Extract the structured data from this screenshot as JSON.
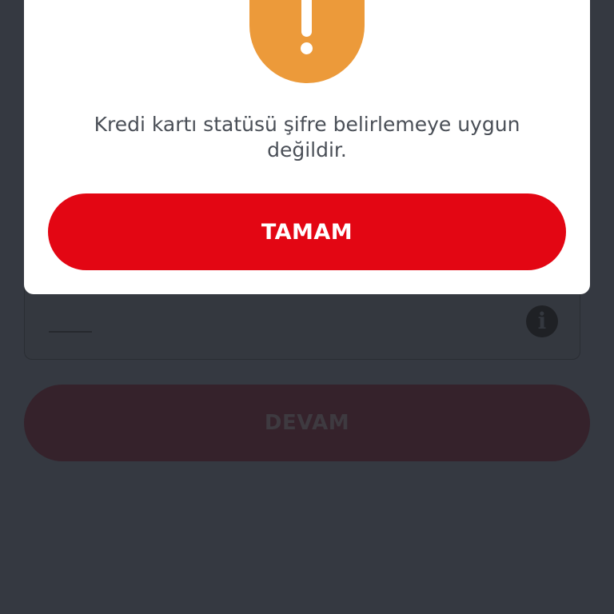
{
  "background_form": {
    "continue_label": "DEVAM",
    "info_icon": "info-icon",
    "info_icon_glyph": "i"
  },
  "dialog": {
    "icon": "warning-icon",
    "message": "Kredi kartı statüsü şifre belirlemeye uygun değildir.",
    "ok_label": "TAMAM"
  },
  "colors": {
    "overlay": "#353941",
    "dialog_bg": "#ffffff",
    "accent_red": "#e30613",
    "warning_orange": "#ec9a3a",
    "message_text": "#4a4f57"
  }
}
